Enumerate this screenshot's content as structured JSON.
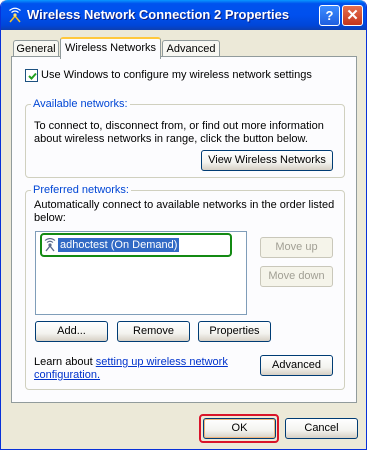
{
  "window": {
    "title": "Wireless Network Connection 2 Properties",
    "help_label": "?",
    "close_label": "✕"
  },
  "tabs": [
    {
      "label": "General",
      "active": false
    },
    {
      "label": "Wireless Networks",
      "active": true
    },
    {
      "label": "Advanced",
      "active": false
    }
  ],
  "use_windows": {
    "label": "Use Windows to configure my wireless network settings",
    "checked": true
  },
  "available": {
    "title": "Available networks:",
    "description_line1": "To connect to, disconnect from, or find out more information",
    "description_line2": "about wireless networks in range, click the button below.",
    "view_button": "View Wireless Networks"
  },
  "preferred": {
    "title": "Preferred networks:",
    "description_line1": "Automatically connect to available networks in the order listed",
    "description_line2": "below:",
    "networks": [
      {
        "name": "adhoctest (On Demand)",
        "selected": true
      }
    ],
    "move_up": "Move up",
    "move_down": "Move down",
    "add_button": "Add...",
    "remove_button": "Remove",
    "properties_button": "Properties"
  },
  "learn": {
    "prefix": "Learn about ",
    "link_line1": "setting up wireless network",
    "link_line2": "configuration.",
    "advanced_button": "Advanced"
  },
  "footer": {
    "ok": "OK",
    "cancel": "Cancel"
  }
}
